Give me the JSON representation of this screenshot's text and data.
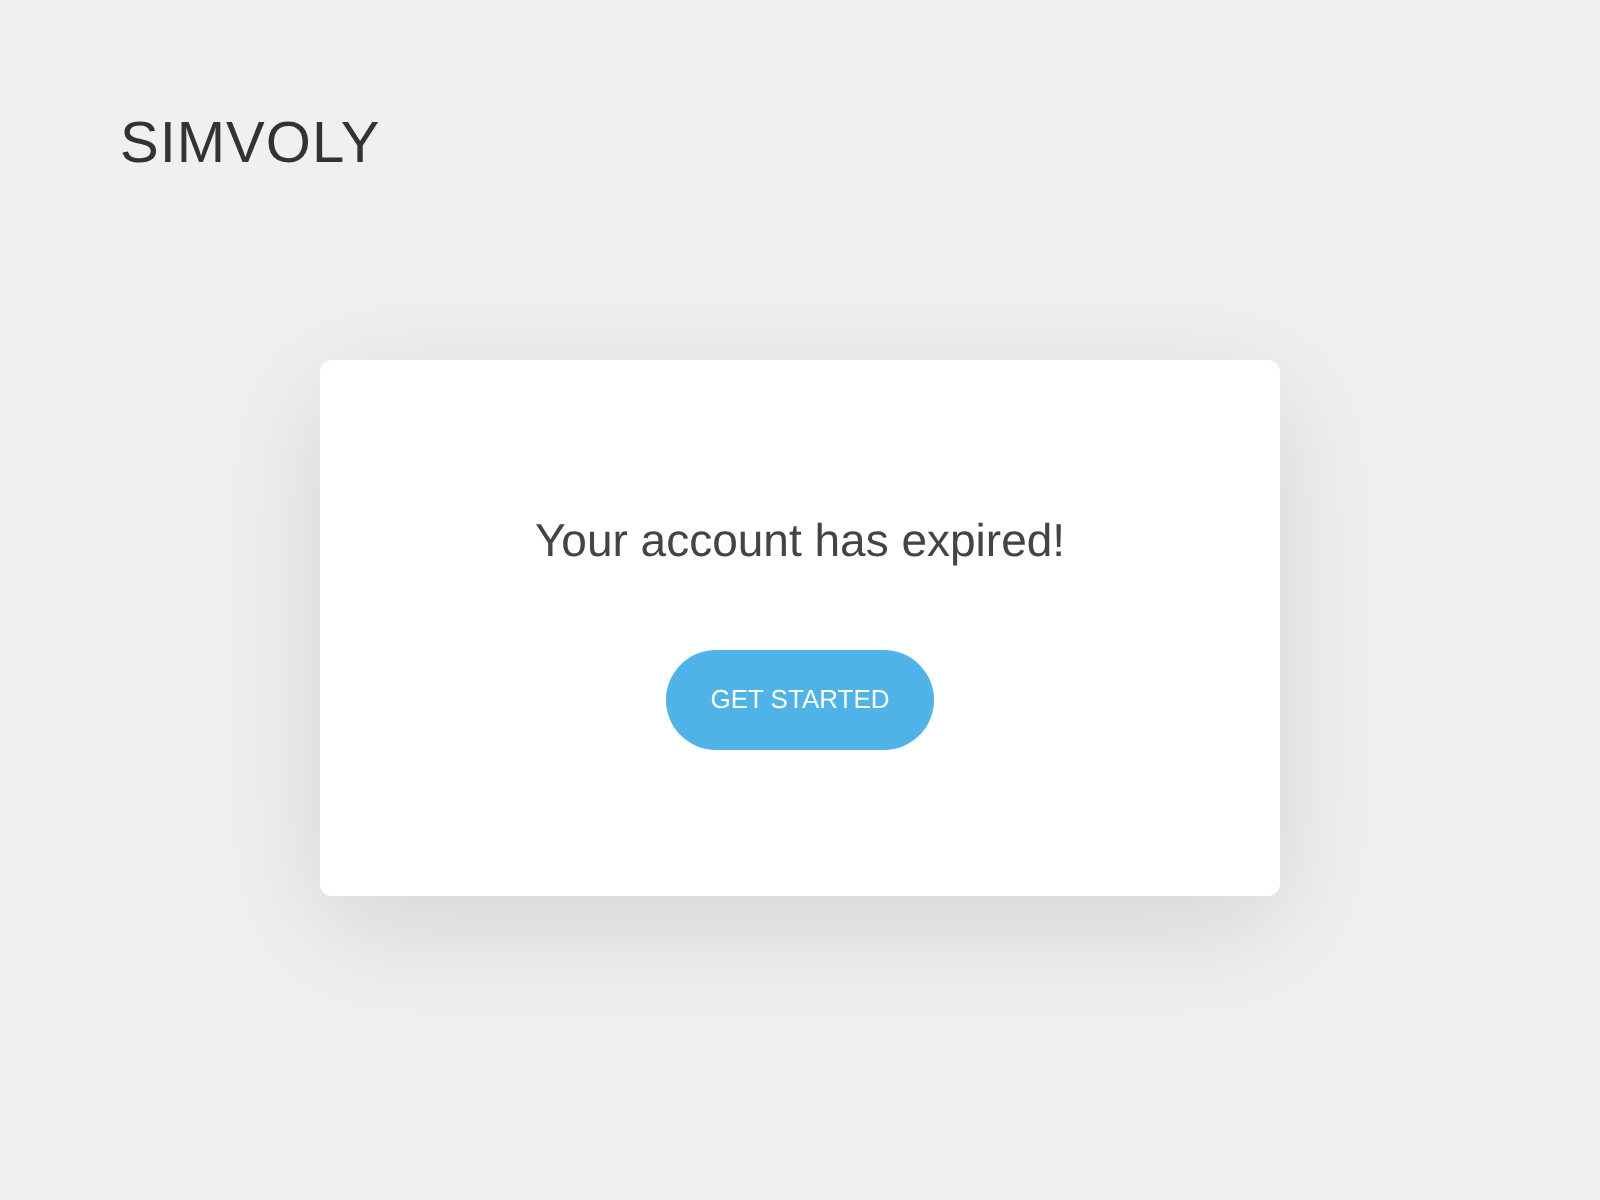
{
  "logo": {
    "text": "SIMVOLY"
  },
  "card": {
    "message": "Your account has expired!",
    "button": "GET STARTED"
  }
}
